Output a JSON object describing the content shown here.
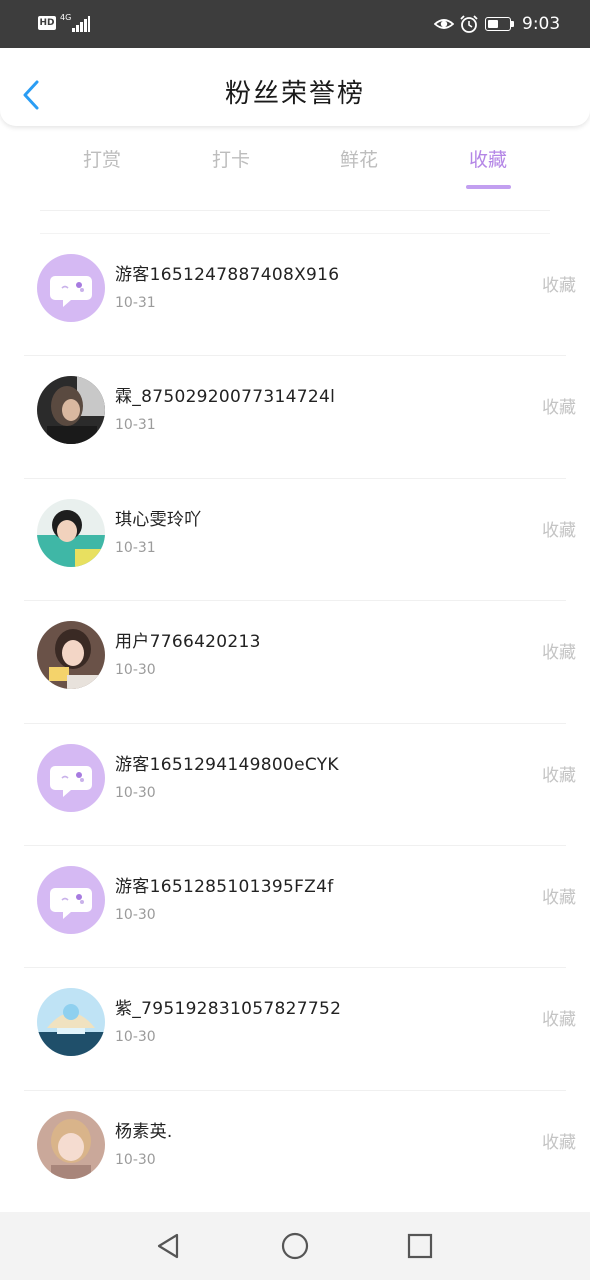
{
  "status_bar": {
    "hd": "HD",
    "network": "4G",
    "time": "9:03",
    "battery_level": 0.5
  },
  "header": {
    "title": "粉丝荣誉榜",
    "back_icon": "chevron-left-icon"
  },
  "tabs": [
    {
      "label": "打赏",
      "active": false
    },
    {
      "label": "打卡",
      "active": false
    },
    {
      "label": "鲜花",
      "active": false
    },
    {
      "label": "收藏",
      "active": true
    }
  ],
  "colors": {
    "accent": "#b486e6",
    "placeholder_avatar_bg": "#d5b9f3",
    "action_text": "#c4c4c4"
  },
  "list": [
    {
      "name": "游客1651247887408X916",
      "date": "10-31",
      "action": "收藏",
      "avatar": "chat-placeholder-avatar"
    },
    {
      "name": "霖_87502920077314724l",
      "date": "10-31",
      "action": "收藏",
      "avatar": "user-photo-avatar"
    },
    {
      "name": "琪心雯玲吖",
      "date": "10-31",
      "action": "收藏",
      "avatar": "user-photo-avatar"
    },
    {
      "name": "用户7766420213",
      "date": "10-30",
      "action": "收藏",
      "avatar": "user-photo-avatar"
    },
    {
      "name": "游客1651294149800eCYK",
      "date": "10-30",
      "action": "收藏",
      "avatar": "chat-placeholder-avatar"
    },
    {
      "name": "游客1651285101395FZ4f",
      "date": "10-30",
      "action": "收藏",
      "avatar": "chat-placeholder-avatar"
    },
    {
      "name": "紫_7951928310578277​52",
      "date": "10-30",
      "action": "收藏",
      "avatar": "user-photo-avatar"
    },
    {
      "name": "杨素英.",
      "date": "10-30",
      "action": "收藏",
      "avatar": "user-photo-avatar"
    }
  ],
  "nav_bar": {
    "back": "triangle-back-icon",
    "home": "circle-home-icon",
    "recents": "square-recents-icon"
  }
}
